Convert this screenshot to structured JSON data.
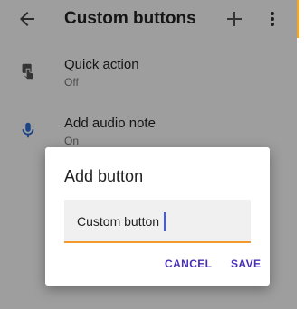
{
  "toolbar": {
    "title": "Custom buttons",
    "back_icon": "arrow-back-icon",
    "add_icon": "plus-icon",
    "more_icon": "more-vert-icon"
  },
  "list": [
    {
      "icon": "touch-gesture-icon",
      "title": "Quick action",
      "status": "Off"
    },
    {
      "icon": "microphone-icon",
      "title": "Add audio note",
      "status": "On"
    }
  ],
  "dialog": {
    "title": "Add button",
    "input_value": "Custom button",
    "cancel_label": "CANCEL",
    "save_label": "SAVE"
  },
  "colors": {
    "accent": "#f29a2e",
    "dialog_action": "#4a2fb8",
    "mic_icon": "#2f6fd6",
    "caret": "#3d5afe"
  }
}
